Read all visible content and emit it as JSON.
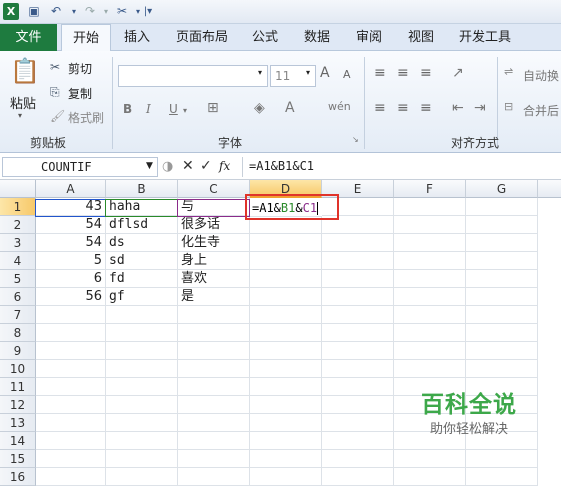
{
  "quick_access": {
    "icons": [
      "excel-icon",
      "save-icon",
      "undo-icon",
      "redo-icon",
      "tools-icon",
      "customize-icon"
    ]
  },
  "tabs": [
    "文件",
    "开始",
    "插入",
    "页面布局",
    "公式",
    "数据",
    "审阅",
    "视图",
    "开发工具"
  ],
  "ribbon": {
    "clipboard": {
      "paste": "粘贴",
      "cut": "剪切",
      "copy": "复制",
      "format_painter": "格式刷",
      "label": "剪贴板"
    },
    "font": {
      "size": "11",
      "label": "字体",
      "bold": "B",
      "italic": "I",
      "underline": "U",
      "grow": "A",
      "shrink": "A"
    },
    "alignment": {
      "wrap": "自动换",
      "merge": "合并后",
      "label": "对齐方式"
    }
  },
  "formula_bar": {
    "name_box": "COUNTIF",
    "cancel": "✕",
    "enter": "✓",
    "fx": "fx",
    "formula": "=A1&B1&C1"
  },
  "columns": [
    "A",
    "B",
    "C",
    "D",
    "E",
    "F",
    "G"
  ],
  "rows": [
    "1",
    "2",
    "3",
    "4",
    "5",
    "6",
    "7",
    "8",
    "9",
    "10",
    "11",
    "12",
    "13",
    "14",
    "15",
    "16"
  ],
  "cells": {
    "A": [
      "43",
      "54",
      "54",
      "5",
      "6",
      "56"
    ],
    "B": [
      "haha",
      "dflsd",
      "ds",
      "sd",
      "fd",
      "gf"
    ],
    "C": [
      "与",
      "很多话",
      "化生寺",
      "身上",
      "喜欢",
      "是"
    ],
    "D1": {
      "p1": "=A1&",
      "p2": "B1",
      "p3": "&",
      "p4": "C1"
    }
  },
  "watermark": {
    "title": "百科全说",
    "subtitle": "助你轻松解决"
  },
  "colors": {
    "ref_a": "#2255cc",
    "ref_b": "#2a8a2a",
    "ref_c": "#8a2b8a",
    "highlight": "#e0332a"
  }
}
